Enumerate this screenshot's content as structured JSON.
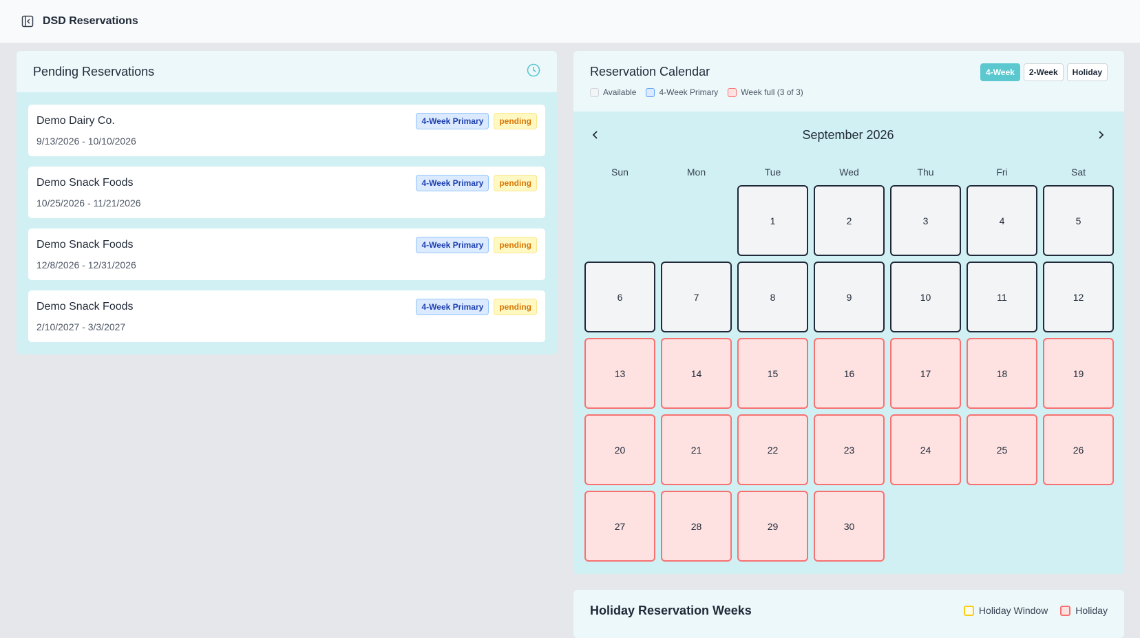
{
  "header": {
    "app_title": "DSD Reservations"
  },
  "pending": {
    "title": "Pending Reservations",
    "items": [
      {
        "name": "Demo Dairy Co.",
        "dates": "9/13/2026 - 10/10/2026",
        "type": "4-Week Primary",
        "status": "pending"
      },
      {
        "name": "Demo Snack Foods",
        "dates": "10/25/2026 - 11/21/2026",
        "type": "4-Week Primary",
        "status": "pending"
      },
      {
        "name": "Demo Snack Foods",
        "dates": "12/8/2026 - 12/31/2026",
        "type": "4-Week Primary",
        "status": "pending"
      },
      {
        "name": "Demo Snack Foods",
        "dates": "2/10/2027 - 3/3/2027",
        "type": "4-Week Primary",
        "status": "pending"
      }
    ]
  },
  "calendar": {
    "title": "Reservation Calendar",
    "views": [
      "4-Week",
      "2-Week",
      "Holiday"
    ],
    "active_view": "4-Week",
    "legend": [
      "Available",
      "4-Week Primary",
      "Week full (3 of 3)"
    ],
    "month_label": "September 2026",
    "weekdays": [
      "Sun",
      "Mon",
      "Tue",
      "Wed",
      "Thu",
      "Fri",
      "Sat"
    ],
    "leading_blanks": 2,
    "days": [
      {
        "n": "1",
        "state": "avail"
      },
      {
        "n": "2",
        "state": "avail"
      },
      {
        "n": "3",
        "state": "avail"
      },
      {
        "n": "4",
        "state": "avail"
      },
      {
        "n": "5",
        "state": "avail"
      },
      {
        "n": "6",
        "state": "avail"
      },
      {
        "n": "7",
        "state": "avail"
      },
      {
        "n": "8",
        "state": "avail"
      },
      {
        "n": "9",
        "state": "avail"
      },
      {
        "n": "10",
        "state": "avail"
      },
      {
        "n": "11",
        "state": "avail"
      },
      {
        "n": "12",
        "state": "avail"
      },
      {
        "n": "13",
        "state": "full"
      },
      {
        "n": "14",
        "state": "full"
      },
      {
        "n": "15",
        "state": "full"
      },
      {
        "n": "16",
        "state": "full"
      },
      {
        "n": "17",
        "state": "full"
      },
      {
        "n": "18",
        "state": "full"
      },
      {
        "n": "19",
        "state": "full"
      },
      {
        "n": "20",
        "state": "full"
      },
      {
        "n": "21",
        "state": "full"
      },
      {
        "n": "22",
        "state": "full"
      },
      {
        "n": "23",
        "state": "full"
      },
      {
        "n": "24",
        "state": "full"
      },
      {
        "n": "25",
        "state": "full"
      },
      {
        "n": "26",
        "state": "full"
      },
      {
        "n": "27",
        "state": "full"
      },
      {
        "n": "28",
        "state": "full"
      },
      {
        "n": "29",
        "state": "full"
      },
      {
        "n": "30",
        "state": "full"
      }
    ]
  },
  "holiday": {
    "title": "Holiday Reservation Weeks",
    "legend": [
      "Holiday Window",
      "Holiday"
    ]
  },
  "colors": {
    "accent": "#5bc8d0",
    "panel_bg": "#d1f0f3",
    "full_bg": "#fee2e2",
    "full_border": "#f87171"
  }
}
